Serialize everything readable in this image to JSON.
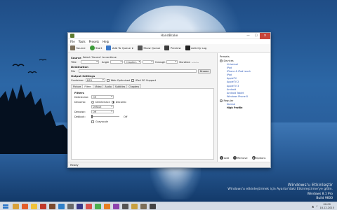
{
  "window": {
    "title": "HandBrake",
    "controls": [
      "—",
      "☐",
      "✕"
    ]
  },
  "menu": [
    "File",
    "Tools",
    "Presets",
    "Help"
  ],
  "toolbar": {
    "source": "Source",
    "start": "Start",
    "add_to_queue": "Add To Queue",
    "show_queue": "Show Queue",
    "preview": "Preview",
    "activity_log": "Activity Log"
  },
  "source": {
    "heading": "Source",
    "hint": "Select 'Source' to continue",
    "title_label": "Title",
    "angle_label": "Angle",
    "chapters_value": "Chapters",
    "through_label": "through",
    "duration_label": "Duration",
    "duration_value": "--:--:--"
  },
  "destination": {
    "heading": "Destination",
    "file_label": "File",
    "browse": "Browse"
  },
  "output": {
    "heading": "Output Settings",
    "container_label": "Container:",
    "container_value": "MP4",
    "web_optimized": "Web Optimized",
    "ipod_support": "iPod 5G Support"
  },
  "tabs": [
    "Picture",
    "Filters",
    "Video",
    "Audio",
    "Subtitles",
    "Chapters"
  ],
  "active_tab": "Filters",
  "filters": {
    "heading": "Filters",
    "detelecine_label": "Detelecine:",
    "detelecine_value": "Off",
    "decomb_label": "Decomb:",
    "deinterlace_option": "Deinterlace",
    "decomb_option": "Decomb",
    "decomb_value": "Default",
    "denoise_label": "Denoise:",
    "denoise_value": "Off",
    "deblock_label": "Deblock:",
    "deblock_value": "Off",
    "grayscale": "Grayscale"
  },
  "presets": {
    "heading": "Presets",
    "groups": [
      {
        "name": "Devices",
        "items": [
          "Universal",
          "iPod",
          "iPhone & iPod touch",
          "iPad",
          "AppleTV",
          "AppleTV 2",
          "AppleTV 3",
          "Android",
          "Android Tablet",
          "Windows Phone 8"
        ]
      },
      {
        "name": "Regular",
        "items": [
          "Normal",
          "High Profile"
        ]
      }
    ],
    "bold_item": "High Profile",
    "actions": {
      "add": "Add",
      "remove": "Remove",
      "options": "Options"
    }
  },
  "status": "Ready",
  "desktop": {
    "watermark_title": "Windows'u Etkinleştir",
    "watermark_text": "Windows'u etkinleştirmek için Ayarlar'daki Etkinleştirme'ye gidin.",
    "build_line1": "Windows 8.1 Pro",
    "build_line2": "Build 9600"
  },
  "taskbar": {
    "time": "00:00",
    "date": "18.12.2015"
  },
  "colors": {
    "accent": "#2a57b8",
    "start_green": "#3d9b3a",
    "close_red": "#c7463b"
  }
}
